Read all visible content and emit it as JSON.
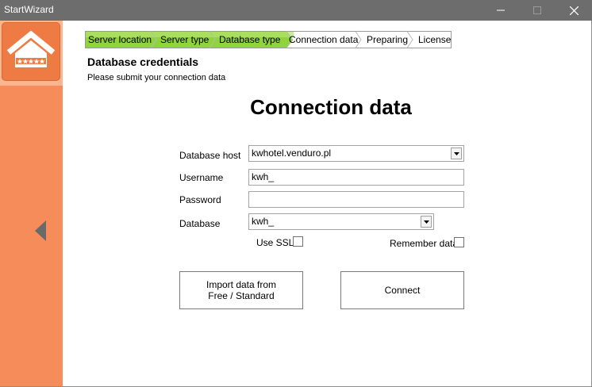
{
  "window": {
    "title": "StartWizard"
  },
  "steps": [
    {
      "label": "Server location",
      "done": true
    },
    {
      "label": "Server type",
      "done": true
    },
    {
      "label": "Database type",
      "done": true
    },
    {
      "label": "Connection data",
      "done": false
    },
    {
      "label": "Preparing",
      "done": false
    },
    {
      "label": "License",
      "done": false
    }
  ],
  "section": {
    "title": "Database credentials",
    "subtitle": "Please submit your connection data"
  },
  "heading": "Connection data",
  "form": {
    "host_label": "Database host",
    "host_value": "kwhotel.venduro.pl",
    "username_label": "Username",
    "username_value": "kwh_",
    "password_label": "Password",
    "password_value": "",
    "database_label": "Database",
    "database_value": "kwh_",
    "ssl_label": "Use SSL",
    "remember_label": "Remember data"
  },
  "buttons": {
    "import_line1": "Import data from",
    "import_line2": "Free / Standard",
    "connect": "Connect"
  },
  "colors": {
    "sidebar": "#f68c5a",
    "step_done": "#8fd43a",
    "titlebar": "#6d6d6d"
  }
}
